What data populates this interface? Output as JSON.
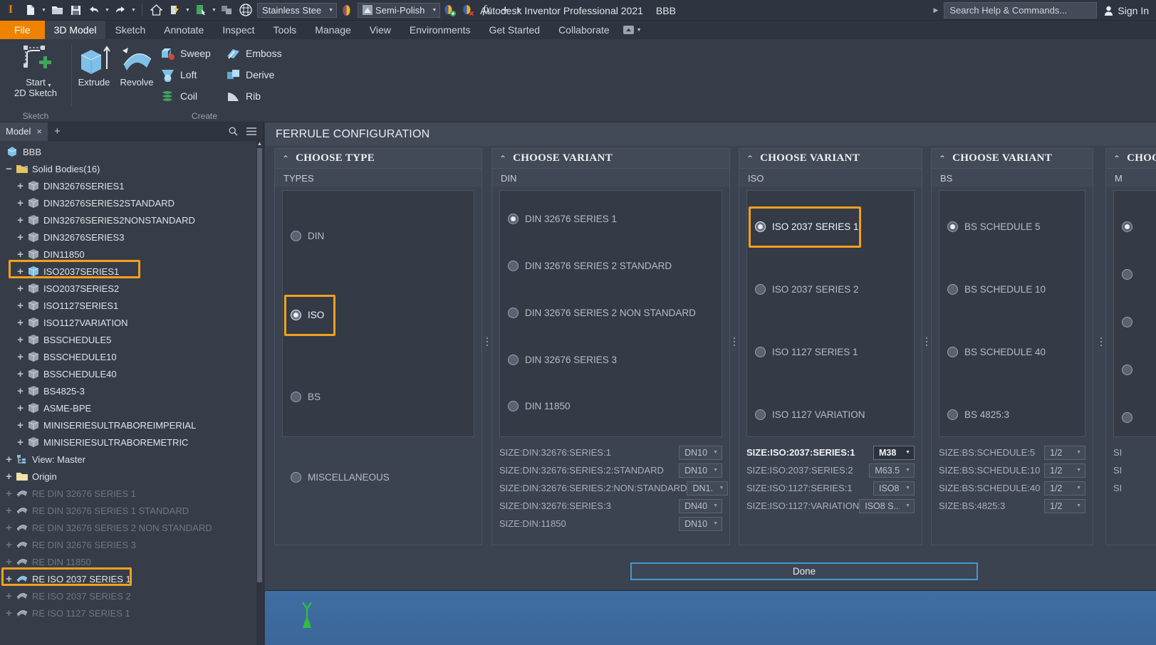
{
  "titlebar": {
    "app_logo": "inventor-logo",
    "quick_access": [
      {
        "name": "new-file",
        "icon": "document-icon",
        "caret": true
      },
      {
        "name": "open-file",
        "icon": "folder-open-icon",
        "caret": false
      },
      {
        "name": "save-file",
        "icon": "floppy-disk-icon",
        "caret": false
      },
      {
        "name": "undo",
        "icon": "undo-arrow-icon",
        "caret": true
      },
      {
        "name": "redo",
        "icon": "redo-arrow-icon",
        "caret": true
      },
      {
        "name": "home-view",
        "icon": "home-icon",
        "caret": false
      },
      {
        "name": "appearance-update",
        "icon": "lightning-icon",
        "caret": true
      },
      {
        "name": "select-group",
        "icon": "select-box-icon",
        "caret": true
      },
      {
        "name": "component-color",
        "icon": "cubes-icon",
        "caret": false
      },
      {
        "name": "checker-sphere",
        "icon": "sphere-icon",
        "caret": false
      }
    ],
    "material_combo": {
      "label": "Stainless Stee",
      "name": "material-selector"
    },
    "appearance_combo": {
      "label": "Semi-Polish",
      "name": "appearance-selector"
    },
    "extra_icons": [
      {
        "name": "adjust-appearance-icon"
      },
      {
        "name": "clear-appearance-icon"
      },
      {
        "name": "fx-parameters-icon"
      },
      {
        "name": "add-icon"
      },
      {
        "name": "customize-caret-icon"
      }
    ],
    "app_title": "Autodesk Inventor Professional 2021",
    "document_name": "BBB",
    "search_placeholder": "Search Help & Commands...",
    "sign_in": "Sign In"
  },
  "ribbon": {
    "tabs": [
      {
        "label": "File",
        "name": "tab-file",
        "style": "file"
      },
      {
        "label": "3D Model",
        "name": "tab-3d-model",
        "style": "active"
      },
      {
        "label": "Sketch",
        "name": "tab-sketch",
        "style": "normal"
      },
      {
        "label": "Annotate",
        "name": "tab-annotate",
        "style": "normal"
      },
      {
        "label": "Inspect",
        "name": "tab-inspect",
        "style": "normal"
      },
      {
        "label": "Tools",
        "name": "tab-tools",
        "style": "normal"
      },
      {
        "label": "Manage",
        "name": "tab-manage",
        "style": "normal"
      },
      {
        "label": "View",
        "name": "tab-view",
        "style": "normal"
      },
      {
        "label": "Environments",
        "name": "tab-environments",
        "style": "normal"
      },
      {
        "label": "Get Started",
        "name": "tab-get-started",
        "style": "normal"
      },
      {
        "label": "Collaborate",
        "name": "tab-collaborate",
        "style": "normal"
      }
    ],
    "groups": [
      {
        "label": "Sketch",
        "name": "ribbon-group-sketch"
      },
      {
        "label": "Create",
        "name": "ribbon-group-create"
      }
    ],
    "start_sketch": {
      "line1": "Start",
      "line2": "2D Sketch",
      "name": "start-2d-sketch-button"
    },
    "extrude": {
      "label": "Extrude",
      "name": "extrude-button"
    },
    "revolve": {
      "label": "Revolve",
      "name": "revolve-button"
    },
    "small_commands": [
      {
        "label": "Sweep",
        "name": "sweep-button",
        "icon": "sweep-icon"
      },
      {
        "label": "Loft",
        "name": "loft-button",
        "icon": "loft-icon"
      },
      {
        "label": "Coil",
        "name": "coil-button",
        "icon": "coil-icon"
      },
      {
        "label": "Emboss",
        "name": "emboss-button",
        "icon": "emboss-icon"
      },
      {
        "label": "Derive",
        "name": "derive-button",
        "icon": "derive-icon"
      },
      {
        "label": "Rib",
        "name": "rib-button",
        "icon": "rib-icon"
      }
    ]
  },
  "browser": {
    "tab_label": "Model",
    "tab_close": "×",
    "tab_add": "+",
    "search_icon": "search-icon",
    "menu_icon": "hamburger-menu-icon",
    "root": {
      "label": "BBB",
      "icon": "part-icon"
    },
    "folder": {
      "label": "Solid Bodies(16)",
      "icon": "folder-icon"
    },
    "solid_bodies": [
      {
        "label": "DIN32676SERIES1",
        "highlighted": false,
        "selected": false
      },
      {
        "label": "DIN32676SERIES2STANDARD",
        "highlighted": false,
        "selected": false
      },
      {
        "label": "DIN32676SERIES2NONSTANDARD",
        "highlighted": false,
        "selected": false
      },
      {
        "label": "DIN32676SERIES3",
        "highlighted": false,
        "selected": false
      },
      {
        "label": "DIN11850",
        "highlighted": false,
        "selected": false
      },
      {
        "label": "ISO2037SERIES1",
        "highlighted": true,
        "selected": true
      },
      {
        "label": "ISO2037SERIES2",
        "highlighted": false,
        "selected": false
      },
      {
        "label": "ISO1127SERIES1",
        "highlighted": false,
        "selected": false
      },
      {
        "label": "ISO1127VARIATION",
        "highlighted": false,
        "selected": false
      },
      {
        "label": "BSSCHEDULE5",
        "highlighted": false,
        "selected": false
      },
      {
        "label": "BSSCHEDULE10",
        "highlighted": false,
        "selected": false
      },
      {
        "label": "BSSCHEDULE40",
        "highlighted": false,
        "selected": false
      },
      {
        "label": "BS4825-3",
        "highlighted": false,
        "selected": false
      },
      {
        "label": "ASME-BPE",
        "highlighted": false,
        "selected": false
      },
      {
        "label": "MINISERIESULTRABOREIMPERIAL",
        "highlighted": false,
        "selected": false
      },
      {
        "label": "MINISERIESULTRABOREMETRIC",
        "highlighted": false,
        "selected": false
      }
    ],
    "view_master": {
      "label": "View: Master",
      "icon": "view-icon"
    },
    "origin": {
      "label": "Origin",
      "icon": "folder-icon"
    },
    "features": [
      {
        "label": "RE DIN 32676 SERIES 1",
        "dim": true,
        "highlighted": false
      },
      {
        "label": "RE DIN 32676 SERIES 1 STANDARD",
        "dim": true,
        "highlighted": false
      },
      {
        "label": "RE DIN 32676 SERIES 2 NON STANDARD",
        "dim": true,
        "highlighted": false
      },
      {
        "label": "RE  DIN 32676 SERIES 3",
        "dim": true,
        "highlighted": false
      },
      {
        "label": "RE DIN 11850",
        "dim": true,
        "highlighted": false
      },
      {
        "label": "RE ISO 2037 SERIES 1",
        "dim": false,
        "highlighted": true
      },
      {
        "label": "RE ISO 2037 SERIES 2",
        "dim": true,
        "highlighted": false
      },
      {
        "label": "RE ISO 1127 SERIES 1",
        "dim": true,
        "highlighted": false
      }
    ]
  },
  "dialog": {
    "title": "FERRULE CONFIGURATION",
    "done_label": "Done",
    "panels": [
      {
        "name": "choose-type-panel",
        "header": "CHOOSE TYPE",
        "group_label": "TYPES",
        "options": [
          {
            "label": "DIN",
            "selected": false,
            "highlighted": false
          },
          {
            "label": "ISO",
            "selected": true,
            "highlighted": true
          },
          {
            "label": "BS",
            "selected": false,
            "highlighted": false
          },
          {
            "label": "MISCELLANEOUS",
            "selected": false,
            "highlighted": false
          }
        ],
        "sizes": []
      },
      {
        "name": "choose-variant-din-panel",
        "header": "CHOOSE VARIANT",
        "group_label": "DIN",
        "options": [
          {
            "label": "DIN 32676 SERIES 1",
            "selected": true,
            "highlighted": false
          },
          {
            "label": "DIN 32676 SERIES 2 STANDARD",
            "selected": false,
            "highlighted": false
          },
          {
            "label": "DIN 32676 SERIES 2 NON STANDARD",
            "selected": false,
            "highlighted": false
          },
          {
            "label": "DIN 32676 SERIES 3",
            "selected": false,
            "highlighted": false
          },
          {
            "label": "DIN 11850",
            "selected": false,
            "highlighted": false
          }
        ],
        "sizes": [
          {
            "label": "SIZE:DIN:32676:SERIES:1",
            "value": "DN10",
            "active": false
          },
          {
            "label": "SIZE:DIN:32676:SERIES:2:STANDARD",
            "value": "DN10",
            "active": false
          },
          {
            "label": "SIZE:DIN:32676:SERIES:2:NON:STANDARD",
            "value": "DN1...",
            "active": false
          },
          {
            "label": "SIZE:DIN:32676:SERIES:3",
            "value": "DN40",
            "active": false
          },
          {
            "label": "SIZE:DIN:11850",
            "value": "DN10",
            "active": false
          }
        ]
      },
      {
        "name": "choose-variant-iso-panel",
        "header": "CHOOSE VARIANT",
        "group_label": "ISO",
        "options": [
          {
            "label": "ISO 2037 SERIES 1",
            "selected": true,
            "highlighted": true
          },
          {
            "label": "ISO 2037 SERIES 2",
            "selected": false,
            "highlighted": false
          },
          {
            "label": "ISO 1127 SERIES 1",
            "selected": false,
            "highlighted": false
          },
          {
            "label": "ISO 1127 VARIATION",
            "selected": false,
            "highlighted": false
          }
        ],
        "sizes": [
          {
            "label": "SIZE:ISO:2037:SERIES:1",
            "value": "M38",
            "active": true
          },
          {
            "label": "SIZE:ISO:2037:SERIES:2",
            "value": "M63.5",
            "active": false
          },
          {
            "label": "SIZE:ISO:1127:SERIES:1",
            "value": "ISO8",
            "active": false
          },
          {
            "label": "SIZE:ISO:1127:VARIATION",
            "value": "ISO8 S...",
            "active": false
          }
        ]
      },
      {
        "name": "choose-variant-bs-panel",
        "header": "CHOOSE VARIANT",
        "group_label": "BS",
        "options": [
          {
            "label": "BS SCHEDULE 5",
            "selected": true,
            "highlighted": false
          },
          {
            "label": "BS SCHEDULE 10",
            "selected": false,
            "highlighted": false
          },
          {
            "label": "BS SCHEDULE 40",
            "selected": false,
            "highlighted": false
          },
          {
            "label": "BS 4825:3",
            "selected": false,
            "highlighted": false
          }
        ],
        "sizes": [
          {
            "label": "SIZE:BS:SCHEDULE:5",
            "value": "1/2",
            "active": false
          },
          {
            "label": "SIZE:BS:SCHEDULE:10",
            "value": "1/2",
            "active": false
          },
          {
            "label": "SIZE:BS:SCHEDULE:40",
            "value": "1/2",
            "active": false
          },
          {
            "label": "SIZE:BS:4825:3",
            "value": "1/2",
            "active": false
          }
        ]
      },
      {
        "name": "choose-variant-misc-panel",
        "header": "CHOOSE VARIANT",
        "group_label": "M",
        "options": [
          {
            "label": "",
            "selected": true,
            "highlighted": false
          },
          {
            "label": "",
            "selected": false,
            "highlighted": false
          },
          {
            "label": "",
            "selected": false,
            "highlighted": false
          },
          {
            "label": "",
            "selected": false,
            "highlighted": false
          },
          {
            "label": "",
            "selected": false,
            "highlighted": false
          }
        ],
        "sizes": [
          {
            "label": "SI",
            "value": "",
            "active": false
          },
          {
            "label": "SI",
            "value": "",
            "active": false
          },
          {
            "label": "SI",
            "value": "",
            "active": false
          }
        ]
      }
    ]
  },
  "viewport": {
    "axis_label": "Y",
    "axis_color": "#2fbf3f",
    "background_color": "#3f6ea4"
  },
  "colors": {
    "accent_orange": "#f2a01d",
    "file_tab_orange": "#ef8200",
    "done_border_blue": "#3e9ad4",
    "window_bg": "#373d48",
    "panel_bg": "#3b4250",
    "header_bg": "#424a58"
  }
}
